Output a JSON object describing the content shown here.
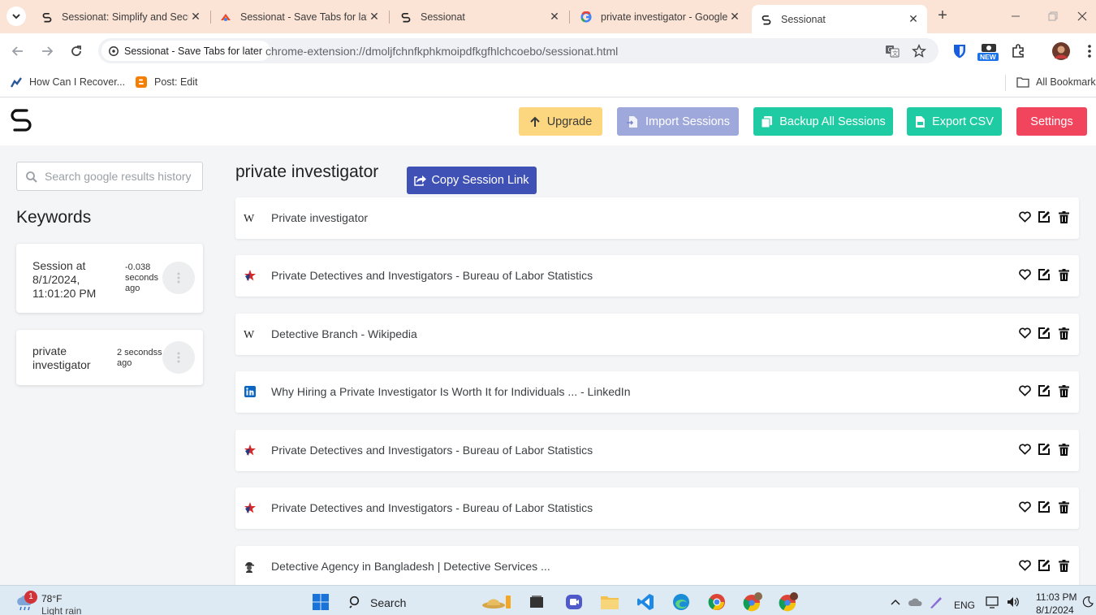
{
  "browser": {
    "tabs": [
      {
        "title": "Sessionat: Simplify and Secu",
        "icon": "sessionat-icon"
      },
      {
        "title": "Sessionat - Save Tabs for late",
        "icon": "sessionat-webstore-icon"
      },
      {
        "title": "Sessionat",
        "icon": "sessionat-icon"
      },
      {
        "title": "private investigator - Google",
        "icon": "google-icon"
      },
      {
        "title": "Sessionat",
        "icon": "sessionat-icon",
        "active": true
      }
    ],
    "omnibox_chip": "Sessionat - Save Tabs for later",
    "url": "chrome-extension://dmoljfchnfkphkmoipdfkgfhlchcoebo/sessionat.html",
    "new_badge": "NEW",
    "bookmarks": [
      {
        "label": "How Can I Recover...",
        "icon": "bookmark-favicon"
      },
      {
        "label": "Post: Edit",
        "icon": "blogger-icon"
      }
    ],
    "all_bookmarks": "All Bookmarks"
  },
  "header": {
    "upgrade": "Upgrade",
    "import": "Import Sessions",
    "backup": "Backup All Sessions",
    "export": "Export CSV",
    "settings": "Settings",
    "colors": {
      "upgrade": "#fcd77f",
      "import": "#9fa8da",
      "backup": "#1fcba3",
      "export": "#1fcba3",
      "settings": "#f0455d"
    }
  },
  "sidebar": {
    "search_placeholder": "Search google results history",
    "keywords_title": "Keywords",
    "sessions": [
      {
        "name": "Session at 8/1/2024, 11:01:20 PM",
        "time": "-0.038 seconds ago"
      },
      {
        "name": "private investigator",
        "time": "2 secondss ago"
      }
    ]
  },
  "main": {
    "session_title": "private investigator",
    "copy_link": "Copy Session Link",
    "results": [
      {
        "title": "Private investigator",
        "icon": "wikipedia-icon"
      },
      {
        "title": "Private Detectives and Investigators - Bureau of Labor Statistics",
        "icon": "bls-star-icon"
      },
      {
        "title": "Detective Branch - Wikipedia",
        "icon": "wikipedia-icon"
      },
      {
        "title": "Why Hiring a Private Investigator Is Worth It for Individuals ... - LinkedIn",
        "icon": "linkedin-icon"
      },
      {
        "title": "Private Detectives and Investigators - Bureau of Labor Statistics",
        "icon": "bls-star-icon"
      },
      {
        "title": "Private Detectives and Investigators - Bureau of Labor Statistics",
        "icon": "bls-star-icon"
      },
      {
        "title": "Detective Agency in Bangladesh | Detective Services ...",
        "icon": "detective-icon"
      }
    ]
  },
  "taskbar": {
    "weather_temp": "78°F",
    "weather_desc": "Light rain",
    "weather_badge": "1",
    "search_label": "Search",
    "language": "ENG",
    "time": "11:03 PM",
    "date": "8/1/2024"
  }
}
